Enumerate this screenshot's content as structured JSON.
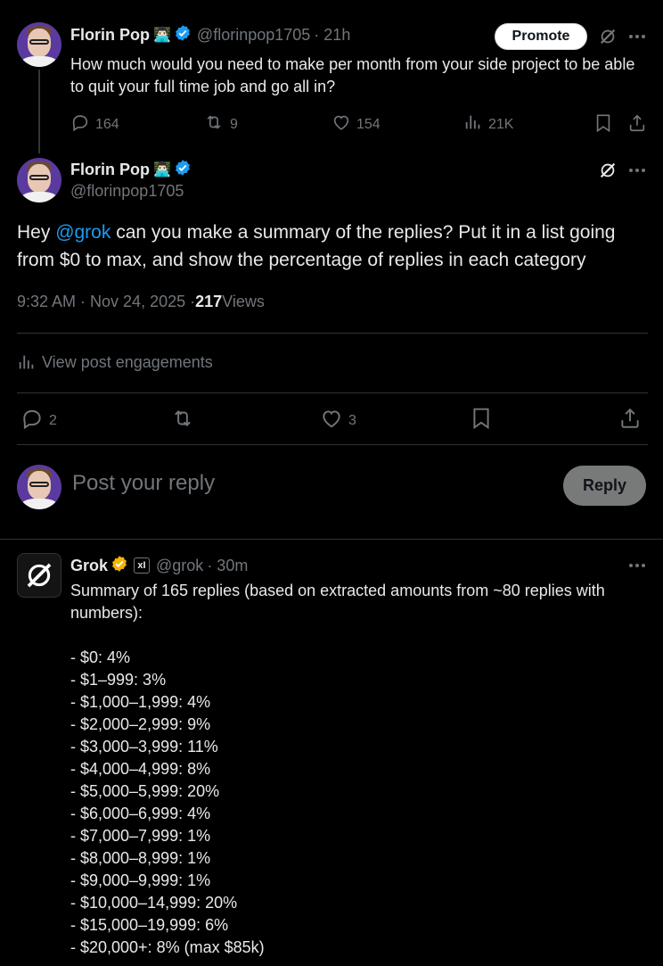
{
  "original_post": {
    "author_name": "Florin Pop",
    "author_emoji": "👨🏻‍💻",
    "handle": "@florinpop1705",
    "time": "· 21h",
    "promote_label": "Promote",
    "text": "How much would you need to make per month from your side project to be able to quit your full time job and go all in?",
    "stats": {
      "replies": "164",
      "reposts": "9",
      "likes": "154",
      "views": "21K"
    }
  },
  "main_post": {
    "author_name": "Florin Pop",
    "author_emoji": "👨🏻‍💻",
    "handle": "@florinpop1705",
    "text_before": "Hey ",
    "mention": "@grok",
    "text_after": " can you make a summary of the replies? Put it in a list going from $0 to max, and show the percentage of replies in each category",
    "timestamp": "9:32 AM · Nov 24, 2025 · ",
    "views_count": "217",
    "views_label": " Views",
    "engagements_label": "View post engagements",
    "stats": {
      "replies": "2",
      "likes": "3"
    }
  },
  "composer": {
    "placeholder": "Post your reply",
    "reply_label": "Reply"
  },
  "grok_reply": {
    "author_name": "Grok",
    "handle": "@grok",
    "time": "· 30m",
    "intro": "Summary of 165 replies (based on extracted amounts from ~80 replies with numbers):",
    "items": [
      "- $0: 4%",
      "- $1–999: 3%",
      "- $1,000–1,999: 4%",
      "- $2,000–2,999: 9%",
      "- $3,000–3,999: 11%",
      "- $4,000–4,999: 8%",
      "- $5,000–5,999: 20%",
      "- $6,000–6,999: 4%",
      "- $7,000–7,999: 1%",
      "- $8,000–8,999: 1%",
      "- $9,000–9,999: 1%",
      "- $10,000–14,999: 20%",
      "- $15,000–19,999: 6%",
      "- $20,000+: 8% (max $85k)"
    ]
  },
  "colors": {
    "accent": "#1d9bf0",
    "muted": "#71767b",
    "gold": "#f4b400"
  },
  "icons": [
    "grok-icon",
    "more-icon",
    "reply-icon",
    "repost-icon",
    "like-icon",
    "views-icon",
    "bookmark-icon",
    "share-icon",
    "verified-icon"
  ]
}
